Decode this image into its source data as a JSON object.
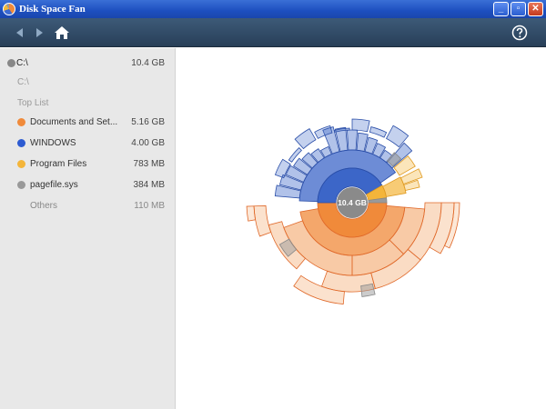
{
  "window": {
    "title": "Disk Space Fan"
  },
  "toolbar": {
    "back": "back",
    "forward": "forward",
    "home": "home",
    "help": "help"
  },
  "sidebar": {
    "root": {
      "name": "C:\\",
      "size": "10.4 GB"
    },
    "path": "C:\\",
    "section_title": "Top List",
    "items": [
      {
        "name": "Documents and Set...",
        "size": "5.16 GB",
        "color": "#f08a3a"
      },
      {
        "name": "WINDOWS",
        "size": "4.00 GB",
        "color": "#2d5bd1"
      },
      {
        "name": "Program Files",
        "size": "783 MB",
        "color": "#f4b53a"
      },
      {
        "name": "pagefile.sys",
        "size": "384 MB",
        "color": "#999999"
      }
    ],
    "others": {
      "name": "Others",
      "size": "110 MB"
    }
  },
  "center_label": "10.4 GB",
  "colors": {
    "orange": "#f08a3a",
    "blue": "#3c66c8",
    "yellow": "#f4b53a",
    "gray": "#999999"
  }
}
